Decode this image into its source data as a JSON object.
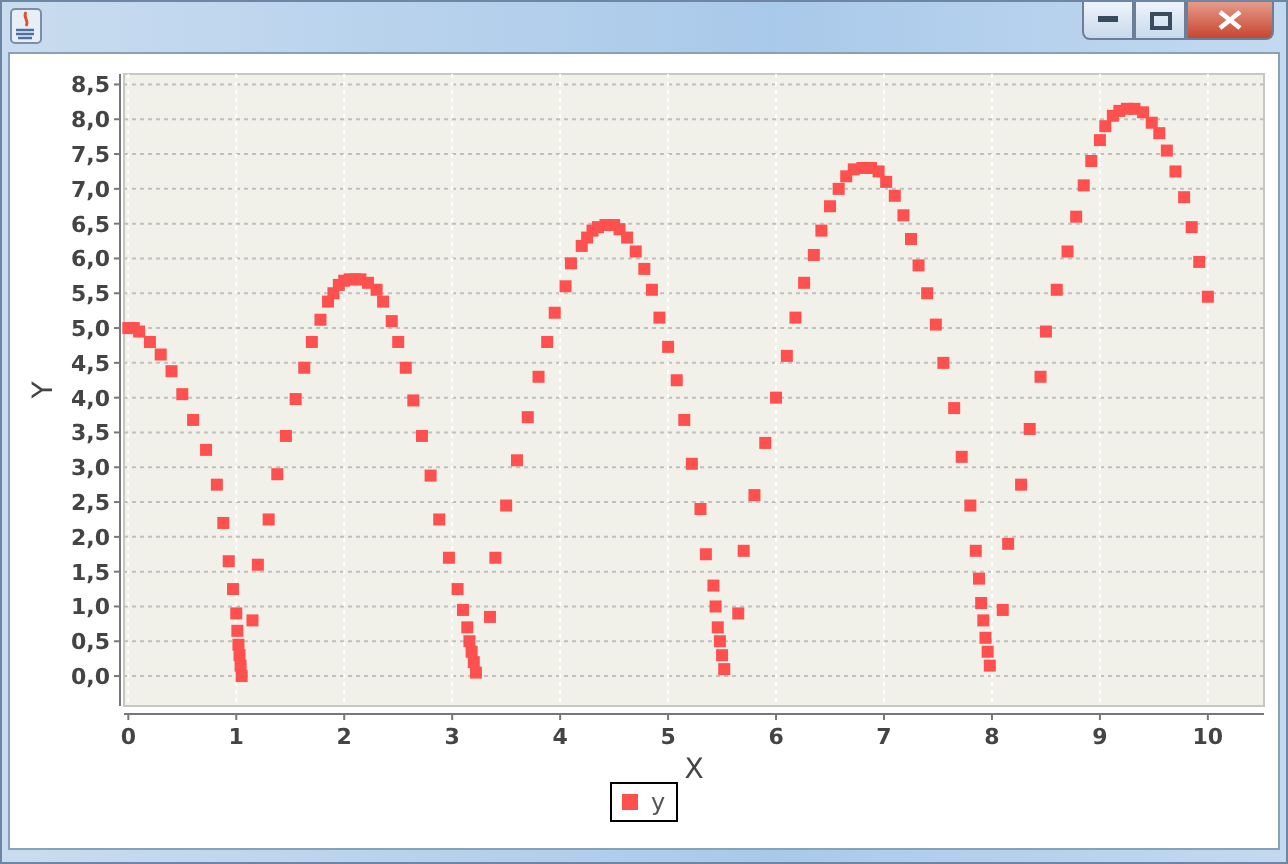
{
  "chart": {
    "chart_data": {
      "type": "scatter",
      "xlabel": "X",
      "ylabel": "Y",
      "x": [
        0,
        0.05,
        0.1,
        0.2,
        0.3,
        0.4,
        0.5,
        0.6,
        0.72,
        0.82,
        0.88,
        0.93,
        0.97,
        1.0,
        1.01,
        1.02,
        1.03,
        1.04,
        1.05,
        1.15,
        1.2,
        1.3,
        1.38,
        1.46,
        1.55,
        1.63,
        1.7,
        1.78,
        1.85,
        1.9,
        1.95,
        2.0,
        2.05,
        2.1,
        2.15,
        2.22,
        2.3,
        2.36,
        2.44,
        2.5,
        2.57,
        2.64,
        2.72,
        2.8,
        2.88,
        2.97,
        3.05,
        3.1,
        3.14,
        3.16,
        3.18,
        3.2,
        3.22,
        3.35,
        3.4,
        3.5,
        3.6,
        3.7,
        3.8,
        3.88,
        3.95,
        4.05,
        4.1,
        4.2,
        4.25,
        4.3,
        4.35,
        4.42,
        4.5,
        4.55,
        4.62,
        4.7,
        4.78,
        4.85,
        4.92,
        5.0,
        5.08,
        5.15,
        5.22,
        5.3,
        5.35,
        5.42,
        5.44,
        5.46,
        5.48,
        5.5,
        5.52,
        5.65,
        5.7,
        5.8,
        5.9,
        6.0,
        6.1,
        6.18,
        6.26,
        6.35,
        6.42,
        6.5,
        6.58,
        6.65,
        6.72,
        6.8,
        6.88,
        6.95,
        7.02,
        7.1,
        7.18,
        7.25,
        7.32,
        7.4,
        7.48,
        7.55,
        7.65,
        7.72,
        7.8,
        7.85,
        7.88,
        7.9,
        7.92,
        7.94,
        7.96,
        7.98,
        8.1,
        8.15,
        8.27,
        8.35,
        8.45,
        8.5,
        8.6,
        8.7,
        8.78,
        8.85,
        8.92,
        9.0,
        9.05,
        9.12,
        9.18,
        9.25,
        9.32,
        9.4,
        9.48,
        9.55,
        9.62,
        9.7,
        9.78,
        9.85,
        9.92,
        10.0
      ],
      "series": [
        {
          "name": "y",
          "color": "#ff5050",
          "values": [
            5.0,
            5.0,
            4.95,
            4.8,
            4.62,
            4.38,
            4.05,
            3.68,
            3.25,
            2.75,
            2.2,
            1.65,
            1.25,
            0.9,
            0.65,
            0.45,
            0.3,
            0.15,
            0.0,
            0.8,
            1.6,
            2.25,
            2.9,
            3.45,
            3.98,
            4.43,
            4.8,
            5.12,
            5.38,
            5.5,
            5.62,
            5.68,
            5.7,
            5.7,
            5.7,
            5.65,
            5.55,
            5.38,
            5.1,
            4.8,
            4.43,
            3.96,
            3.45,
            2.88,
            2.25,
            1.7,
            1.25,
            0.95,
            0.7,
            0.5,
            0.35,
            0.2,
            0.05,
            0.85,
            1.7,
            2.45,
            3.1,
            3.72,
            4.3,
            4.8,
            5.22,
            5.6,
            5.93,
            6.18,
            6.3,
            6.4,
            6.45,
            6.48,
            6.48,
            6.42,
            6.3,
            6.1,
            5.85,
            5.55,
            5.15,
            4.73,
            4.25,
            3.68,
            3.05,
            2.4,
            1.75,
            1.3,
            1.0,
            0.7,
            0.5,
            0.3,
            0.1,
            0.9,
            1.8,
            2.6,
            3.35,
            4.0,
            4.6,
            5.15,
            5.65,
            6.05,
            6.4,
            6.75,
            7.0,
            7.18,
            7.28,
            7.3,
            7.3,
            7.25,
            7.1,
            6.9,
            6.62,
            6.28,
            5.9,
            5.5,
            5.05,
            4.5,
            3.85,
            3.15,
            2.45,
            1.8,
            1.4,
            1.05,
            0.8,
            0.55,
            0.35,
            0.15,
            0.95,
            1.9,
            2.75,
            3.55,
            4.3,
            4.95,
            5.55,
            6.1,
            6.6,
            7.05,
            7.4,
            7.7,
            7.9,
            8.05,
            8.12,
            8.15,
            8.15,
            8.1,
            7.95,
            7.8,
            7.55,
            7.25,
            6.88,
            6.45,
            5.95,
            5.45
          ]
        }
      ],
      "grid": true,
      "xlim": [
        -0.04,
        10.52
      ],
      "ylim": [
        -0.43,
        8.65
      ],
      "xticks": [
        0,
        1,
        2,
        3,
        4,
        5,
        6,
        7,
        8,
        9,
        10
      ],
      "yticks": [
        {
          "value": 0,
          "label": "0,0"
        },
        {
          "value": 0.5,
          "label": "0,5"
        },
        {
          "value": 1,
          "label": "1,0"
        },
        {
          "value": 1.5,
          "label": "1,5"
        },
        {
          "value": 2,
          "label": "2,0"
        },
        {
          "value": 2.5,
          "label": "2,5"
        },
        {
          "value": 3,
          "label": "3,0"
        },
        {
          "value": 3.5,
          "label": "3,5"
        },
        {
          "value": 4,
          "label": "4,0"
        },
        {
          "value": 4.5,
          "label": "4,5"
        },
        {
          "value": 5,
          "label": "5,0"
        },
        {
          "value": 5.5,
          "label": "5,5"
        },
        {
          "value": 6,
          "label": "6,0"
        },
        {
          "value": 6.5,
          "label": "6,5"
        },
        {
          "value": 7,
          "label": "7,0"
        },
        {
          "value": 7.5,
          "label": "7,5"
        },
        {
          "value": 8,
          "label": "8,0"
        },
        {
          "value": 8.5,
          "label": "8,5"
        }
      ]
    }
  }
}
